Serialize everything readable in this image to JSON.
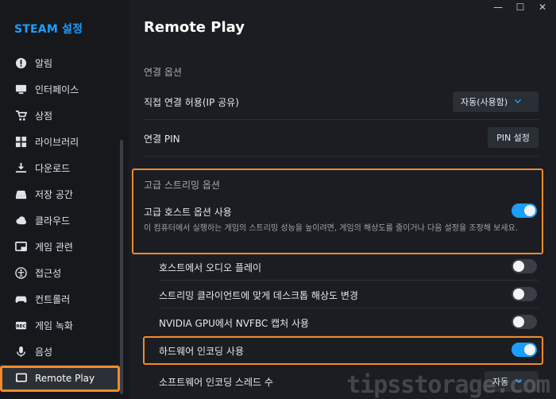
{
  "brand": "STEAM 설정",
  "nav": [
    {
      "label": "알림",
      "icon": "alert-icon"
    },
    {
      "label": "인터페이스",
      "icon": "monitor-icon"
    },
    {
      "label": "상점",
      "icon": "cart-icon"
    },
    {
      "label": "라이브러리",
      "icon": "grid-icon"
    },
    {
      "label": "다운로드",
      "icon": "download-icon"
    },
    {
      "label": "저장 공간",
      "icon": "storage-icon"
    },
    {
      "label": "클라우드",
      "icon": "cloud-icon"
    },
    {
      "label": "게임 관련",
      "icon": "game-window-icon"
    },
    {
      "label": "접근성",
      "icon": "accessibility-icon"
    },
    {
      "label": "컨트롤러",
      "icon": "controller-icon"
    },
    {
      "label": "게임 녹화",
      "icon": "rec-icon"
    },
    {
      "label": "음성",
      "icon": "mic-icon"
    },
    {
      "label": "Remote Play",
      "icon": "cast-icon",
      "active": true
    }
  ],
  "window": {
    "minimize": "—",
    "maximize": "☐",
    "close": "✕"
  },
  "page": {
    "title": "Remote Play"
  },
  "connection": {
    "section_label": "연결 옵션",
    "direct_label": "직접 연결 허용(IP 공유)",
    "direct_value": "자동(사용함)",
    "pin_label": "연결 PIN",
    "pin_button": "PIN 설정"
  },
  "advanced": {
    "section_label": "고급 스트리밍 옵션",
    "host_label": "고급 호스트 옵션 사용",
    "host_desc": "이 컴퓨터에서 실행하는 게임의 스트리밍 성능을 높이려면, 게임의 해상도를 줄이거나 다음 설정을 조정해 보세요.",
    "host_on": true,
    "options": [
      {
        "label": "호스트에서 오디오 플레이",
        "on": false
      },
      {
        "label": "스트리밍 클라이언트에 맞게 데스크톱 해상도 변경",
        "on": false
      },
      {
        "label": "NVIDIA GPU에서 NVFBC 캡처 사용",
        "on": false
      },
      {
        "label": "하드웨어 인코딩 사용",
        "on": true
      }
    ],
    "threads_label": "소프트웨어 인코딩 스레드 수",
    "threads_value": "자동"
  },
  "watermark": "tipsstorage.com",
  "colors": {
    "accent": "#1a9fff",
    "highlight": "#f28a2a",
    "bg": "#1b1d22",
    "sidebar": "#16181c"
  }
}
